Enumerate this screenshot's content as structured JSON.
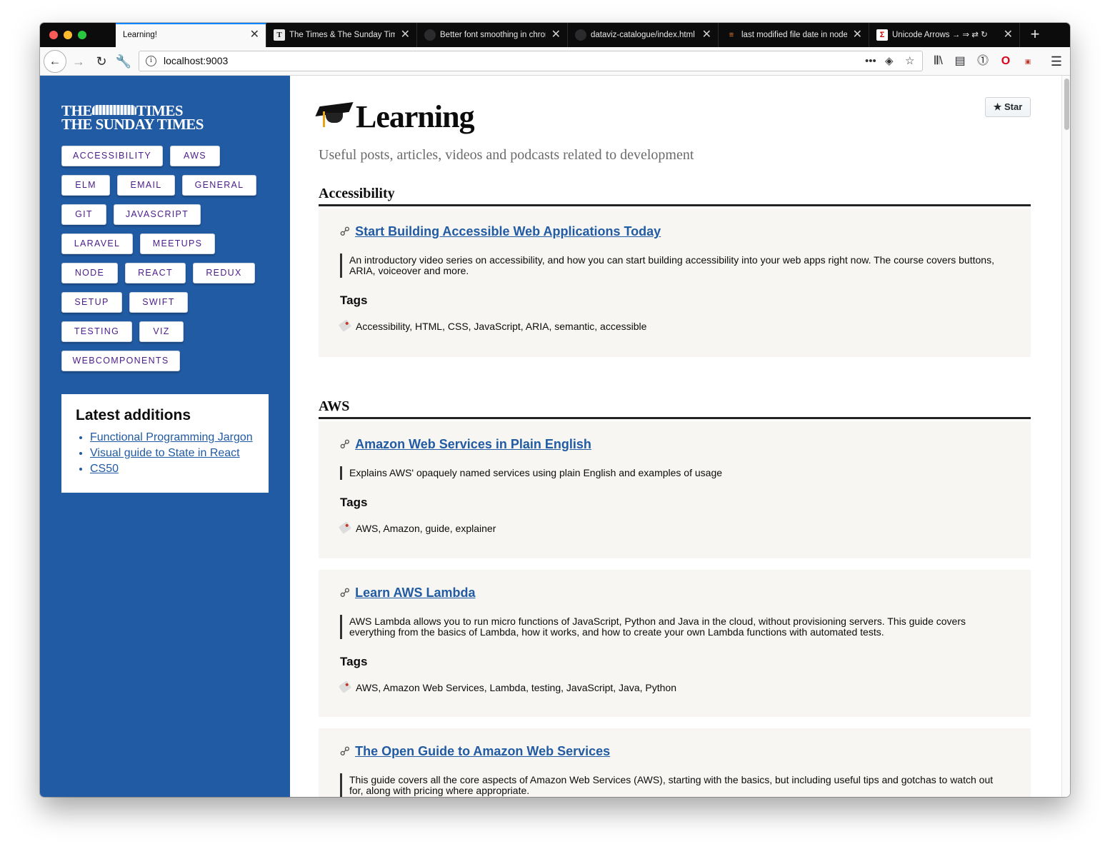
{
  "browser": {
    "tabs": [
      {
        "title": "Learning!",
        "favicon": ""
      },
      {
        "title": "The Times & The Sunday Times",
        "favicon": "T"
      },
      {
        "title": "Better font smoothing in chrome",
        "favicon": "github-icon"
      },
      {
        "title": "dataviz-catalogue/index.html",
        "favicon": "github-icon"
      },
      {
        "title": "last modified file date in node",
        "favicon": "stackoverflow-icon"
      },
      {
        "title": "Unicode Arrows → ⇒ ⇄ ↻",
        "favicon": "sigma-icon"
      }
    ],
    "url": "localhost:9003",
    "colors": {
      "tab_strip": "#0c0c0d",
      "active_tab_accent": "#0a84ff"
    }
  },
  "sidebar": {
    "logo_line1": "THE",
    "logo_line1b": "TIMES",
    "logo_line2": "THE SUNDAY TIMES",
    "topics": [
      "ACCESSIBILITY",
      "AWS",
      "ELM",
      "EMAIL",
      "GENERAL",
      "GIT",
      "JAVASCRIPT",
      "LARAVEL",
      "MEETUPS",
      "NODE",
      "REACT",
      "REDUX",
      "SETUP",
      "SWIFT",
      "TESTING",
      "VIZ",
      "WEBCOMPONENTS"
    ],
    "latest": {
      "heading": "Latest additions",
      "items": [
        "Functional Programming Jargon",
        "Visual guide to State in React",
        "CS50"
      ]
    },
    "colors": {
      "background": "#215ba3",
      "topic_text": "#4b1d8a"
    }
  },
  "main": {
    "title": "Learning",
    "subtitle": "Useful posts, articles, videos and podcasts related to development",
    "star_label": "Star",
    "tags_heading": "Tags",
    "sections": [
      {
        "heading": "Accessibility",
        "cards": [
          {
            "title": "Start Building Accessible Web Applications Today",
            "description": "An introductory video series on accessibility, and how you can start building accessibility into your web apps right now. The course covers buttons, ARIA, voiceover and more.",
            "tags": "Accessibility, HTML, CSS, JavaScript, ARIA, semantic, accessible"
          }
        ]
      },
      {
        "heading": "AWS",
        "cards": [
          {
            "title": "Amazon Web Services in Plain English",
            "description": "Explains AWS' opaquely named services using plain English and examples of usage",
            "tags": "AWS, Amazon, guide, explainer"
          },
          {
            "title": "Learn AWS Lambda",
            "description": "AWS Lambda allows you to run micro functions of JavaScript, Python and Java in the cloud, without provisioning servers. This guide covers everything from the basics of Lambda, how it works, and how to create your own Lambda functions with automated tests.",
            "tags": "AWS, Amazon Web Services, Lambda, testing, JavaScript, Java, Python"
          },
          {
            "title": "The Open Guide to Amazon Web Services",
            "description": "This guide covers all the core aspects of Amazon Web Services (AWS), starting with the basics, but including useful tips and gotchas to watch out for, along with pricing where appropriate.",
            "tags": ""
          }
        ]
      }
    ]
  }
}
